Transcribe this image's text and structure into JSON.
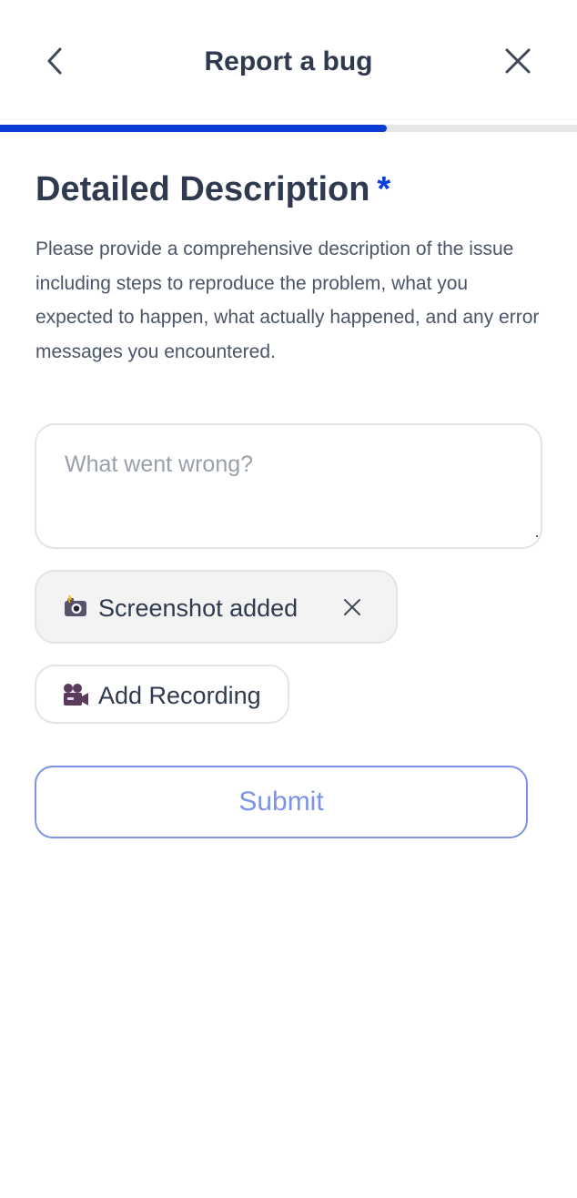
{
  "header": {
    "title": "Report a bug",
    "back_icon": "chevron-left-icon",
    "close_icon": "close-icon"
  },
  "progress": {
    "value": 0.67,
    "fill_color": "#0a3dd8",
    "track_color": "#e6e6e8"
  },
  "section": {
    "title": "Detailed Description",
    "required_marker": "*",
    "description": "Please provide a comprehensive description of the issue including steps to reproduce the problem, what you expected to happen, what actually happened, and any error messages you encountered."
  },
  "textarea": {
    "value": "",
    "placeholder": "What went wrong?"
  },
  "attachments": {
    "screenshot_label": "Screenshot added",
    "screenshot_icon": "camera-flash-icon",
    "remove_icon": "close-icon",
    "recording_label": "Add Recording",
    "recording_icon": "movie-camera-icon"
  },
  "submit": {
    "label": "Submit",
    "color": "#7d93e6"
  },
  "colors": {
    "accent": "#0a3dd8",
    "text": "#2f3a4f",
    "muted_text": "#4a5568",
    "border": "#e3e4e8"
  }
}
